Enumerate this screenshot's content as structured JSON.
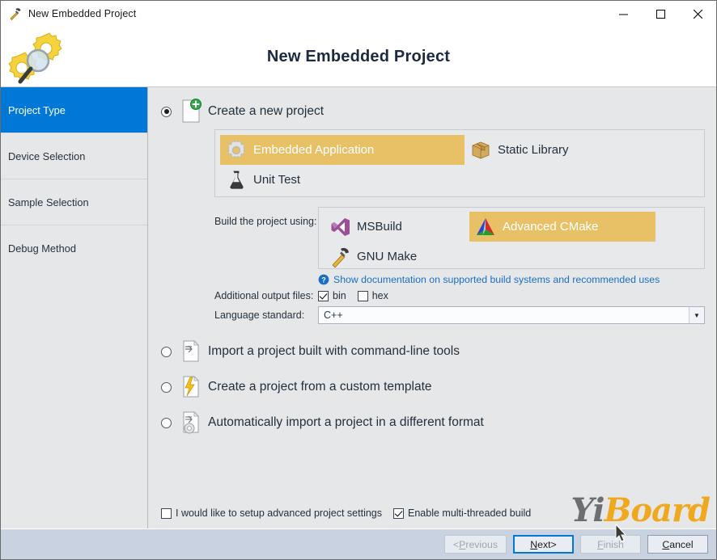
{
  "window": {
    "title": "New Embedded Project",
    "icon": "hammer-icon",
    "minimize_label": "—",
    "maximize_label": "□",
    "close_label": "✕"
  },
  "header": {
    "title": "New Embedded Project",
    "icon": "gears-magnifier-icon"
  },
  "sidebar": {
    "items": [
      {
        "label": "Project Type",
        "active": true
      },
      {
        "label": "Device Selection",
        "active": false
      },
      {
        "label": "Sample Selection",
        "active": false
      },
      {
        "label": "Debug Method",
        "active": false
      }
    ]
  },
  "main": {
    "options": [
      {
        "id": "create-new-project",
        "label": "Create a new project",
        "icon": "new-document-plus-icon",
        "selected": true
      },
      {
        "id": "import-command-line",
        "label": "Import a project built with command-line tools",
        "icon": "import-document-icon",
        "selected": false
      },
      {
        "id": "custom-template",
        "label": "Create a project from a custom template",
        "icon": "lightning-document-icon",
        "selected": false
      },
      {
        "id": "auto-import-different-format",
        "label": "Automatically import a project in a different format",
        "icon": "import-gear-document-icon",
        "selected": false
      }
    ],
    "project_types": [
      {
        "label": "Embedded Application",
        "icon": "gear-icon",
        "selected": true
      },
      {
        "label": "Static Library",
        "icon": "package-box-icon",
        "selected": false
      },
      {
        "label": "Unit Test",
        "icon": "flask-icon",
        "selected": false
      }
    ],
    "build_system": {
      "label": "Build the project using:",
      "items": [
        {
          "label": "MSBuild",
          "icon": "visual-studio-icon",
          "selected": false
        },
        {
          "label": "Advanced CMake",
          "icon": "cmake-triangle-icon",
          "selected": true
        },
        {
          "label": "GNU Make",
          "icon": "hammer-icon",
          "selected": false
        }
      ]
    },
    "doc_link": {
      "icon": "info-question-icon",
      "text": "Show documentation on supported build systems and recommended uses"
    },
    "output_files": {
      "label": "Additional output files:",
      "checkboxes": [
        {
          "label": "bin",
          "checked": true
        },
        {
          "label": "hex",
          "checked": false
        }
      ]
    },
    "language_standard": {
      "label": "Language standard:",
      "value": "C++",
      "arrow": "▼"
    },
    "bottom_checkboxes": [
      {
        "label": "I would like to setup advanced project settings",
        "checked": false
      },
      {
        "label": "Enable multi-threaded build",
        "checked": true
      }
    ],
    "watermark": {
      "part1": "Yi",
      "part2": "Board"
    }
  },
  "footer": {
    "buttons": [
      {
        "id": "previous",
        "prefix": "< ",
        "mnemonic": "P",
        "rest": "revious",
        "suffix": "",
        "state": "disabled"
      },
      {
        "id": "next",
        "prefix": "",
        "mnemonic": "N",
        "rest": "ext",
        "suffix": " >",
        "state": "default"
      },
      {
        "id": "finish",
        "prefix": "",
        "mnemonic": "F",
        "rest": "inish",
        "suffix": "",
        "state": "disabled"
      },
      {
        "id": "cancel",
        "prefix": "",
        "mnemonic": "C",
        "rest": "ancel",
        "suffix": "",
        "state": "normal"
      }
    ]
  },
  "colors": {
    "accent_blue": "#0078d7",
    "selection_gold": "#e8c167",
    "sidebar_bg": "#e6e7e9",
    "footer_bg": "#c8d2e0",
    "link_blue": "#1a6fc4",
    "watermark_gold": "#f0a81e"
  }
}
